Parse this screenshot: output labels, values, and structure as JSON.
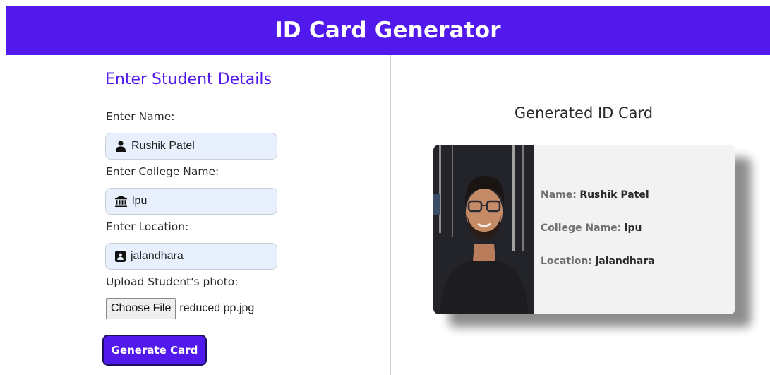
{
  "header": {
    "title": "ID Card Generator"
  },
  "form": {
    "title": "Enter Student Details",
    "name_label": "Enter Name:",
    "name_value": "Rushik Patel",
    "college_label": "Enter College Name:",
    "college_value": "lpu",
    "location_label": "Enter Location:",
    "location_value": "jalandhara",
    "photo_label": "Upload Student's photo:",
    "file_button": "Choose File",
    "file_name": "reduced pp.jpg",
    "generate_button": "Generate Card"
  },
  "card": {
    "heading": "Generated ID Card",
    "name_key": "Name:",
    "name_value": "Rushik Patel",
    "college_key": "College Name:",
    "college_value": "lpu",
    "location_key": "Location:",
    "location_value": "jalandhara"
  },
  "colors": {
    "accent": "#5219ec",
    "field_bg": "#e8f0fe"
  },
  "icons": {
    "name_field": "user-icon",
    "college_field": "institution-icon",
    "location_field": "address-book-icon"
  }
}
